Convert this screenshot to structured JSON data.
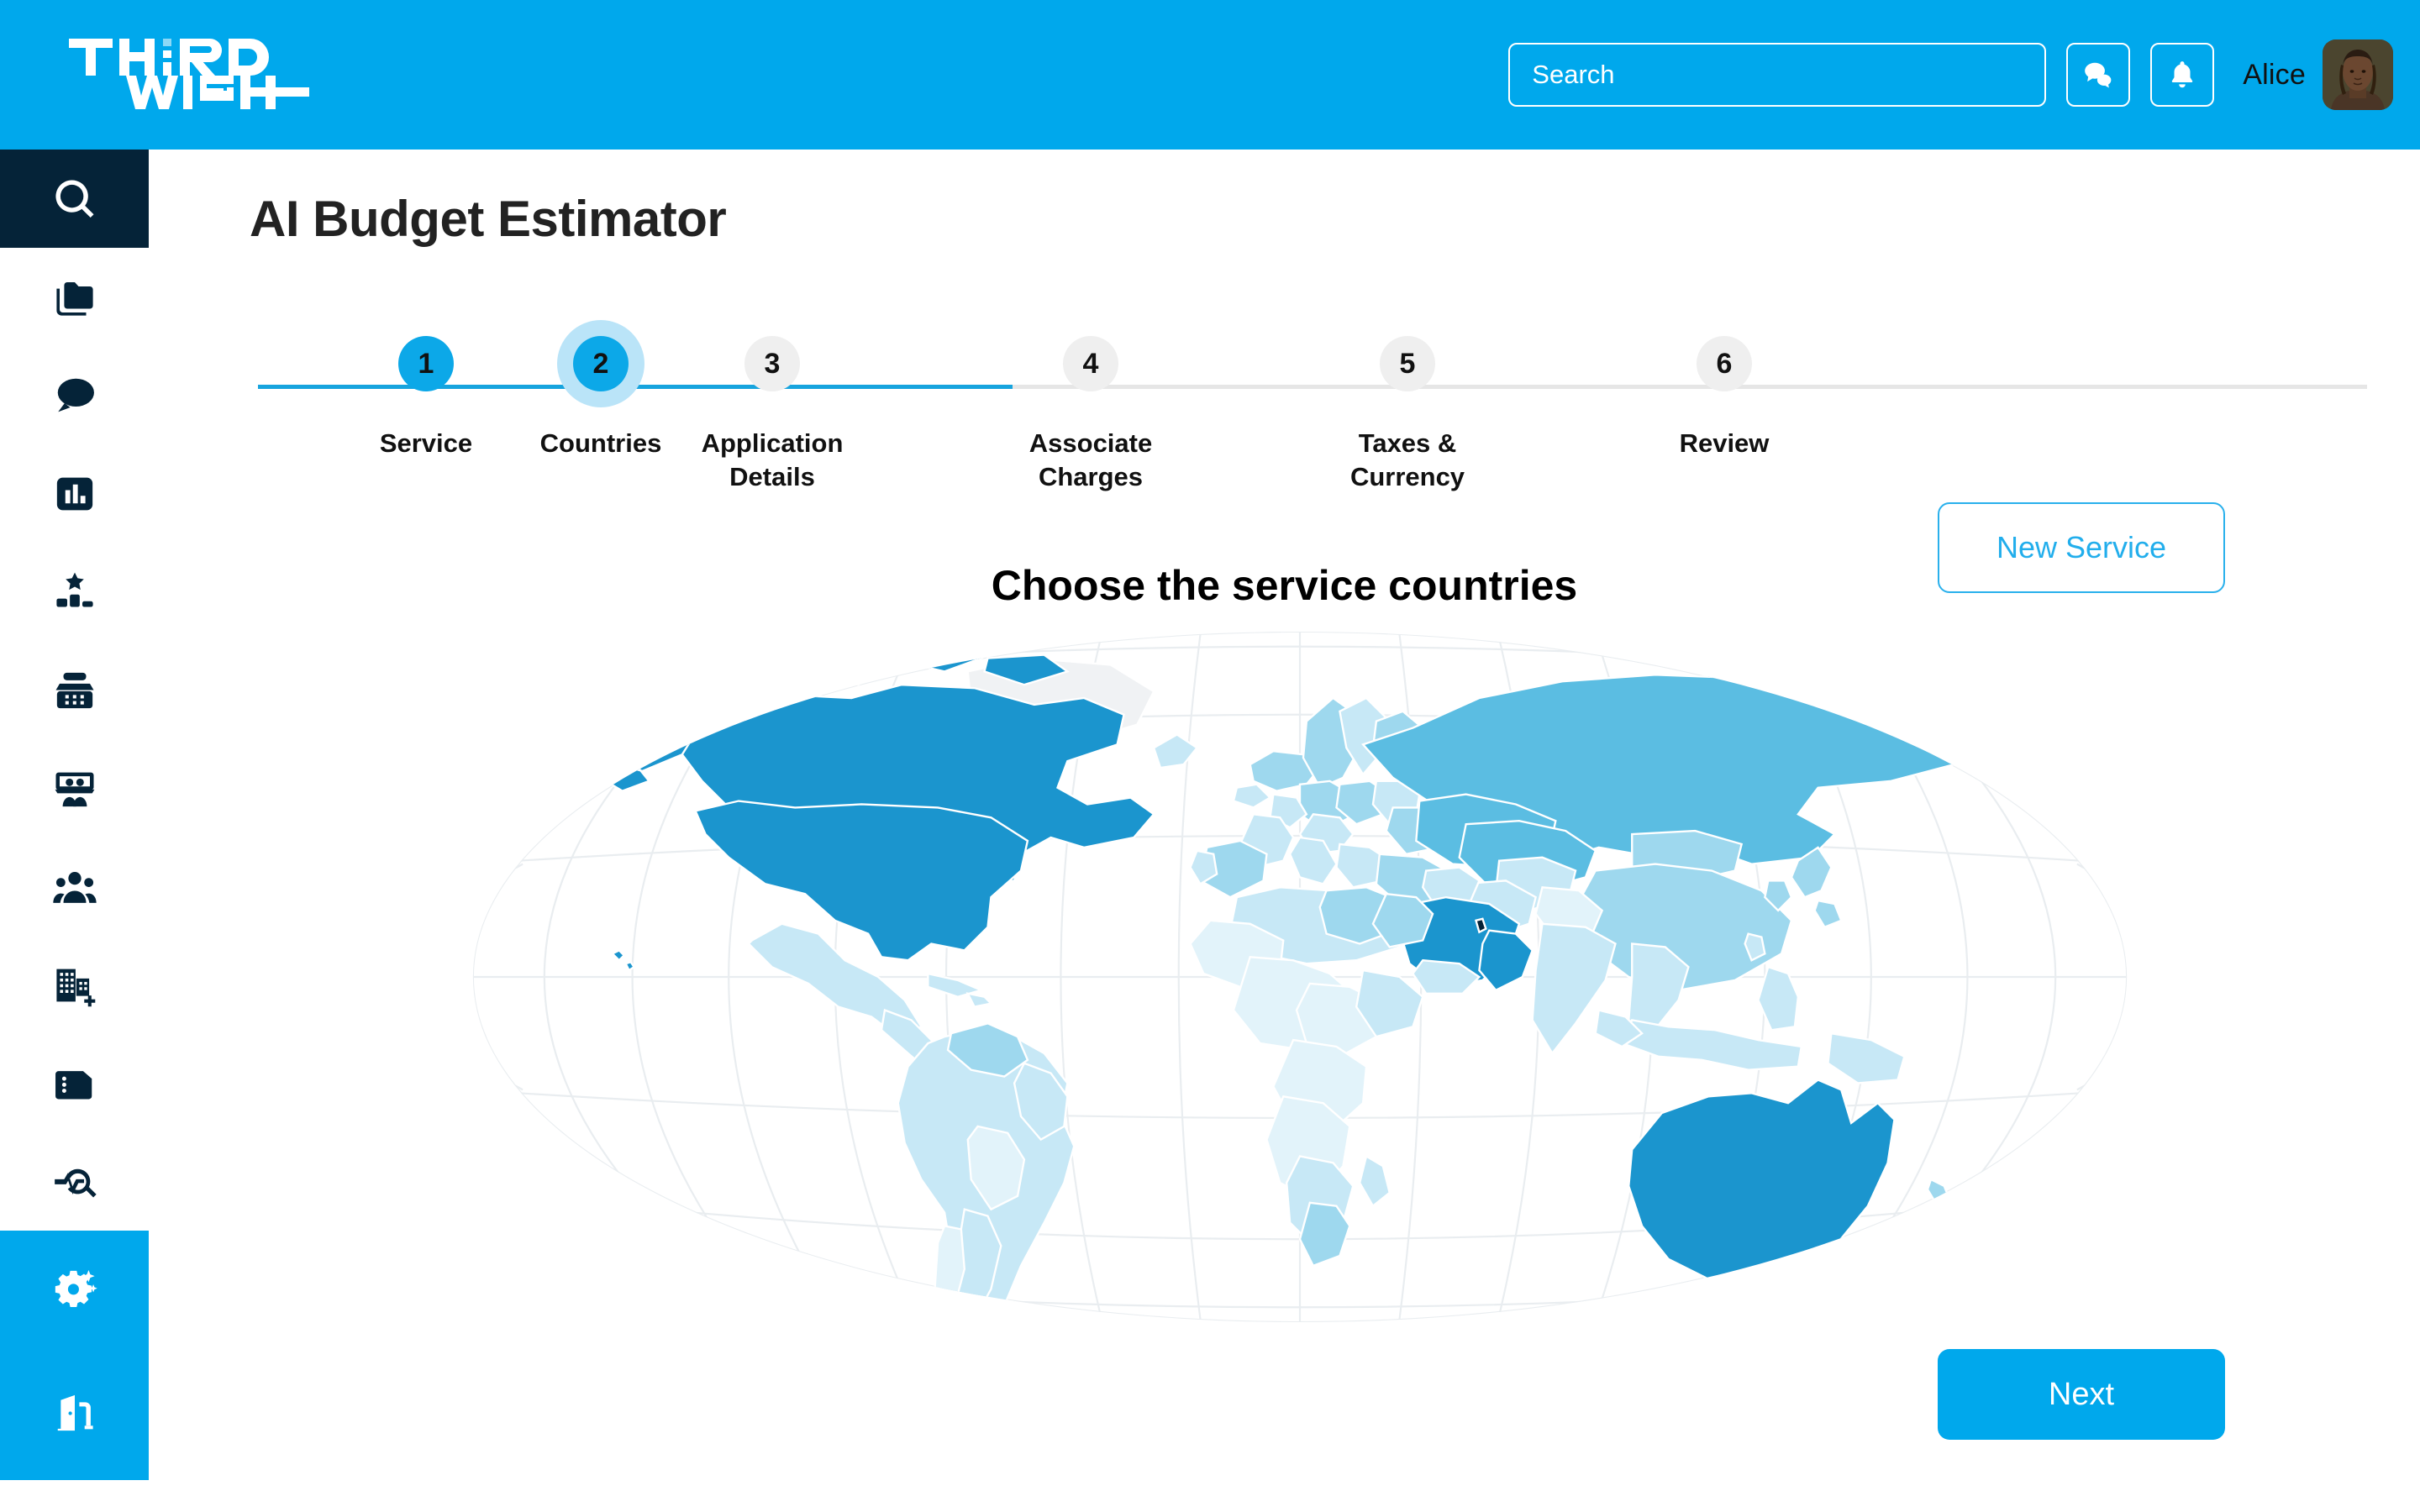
{
  "brand": {
    "logo_text_line1": "THIRD",
    "logo_text_line2": "WISH"
  },
  "header": {
    "search": {
      "placeholder": "Search",
      "value": ""
    },
    "messages_icon": "chat-bubbles-icon",
    "notifications_icon": "bell-icon",
    "user_name": "Alice",
    "background_color": "#00A8EC"
  },
  "sidebar": {
    "items": [
      {
        "icon": "search-icon",
        "name": "search",
        "active": true
      },
      {
        "icon": "folders-icon",
        "name": "folders",
        "active": false
      },
      {
        "icon": "chat-bubble-icon",
        "name": "messages",
        "active": false
      },
      {
        "icon": "bar-chart-icon",
        "name": "reports",
        "active": false
      },
      {
        "icon": "podium-star-icon",
        "name": "rankings",
        "active": false
      },
      {
        "icon": "cash-register-icon",
        "name": "point-of-sale",
        "active": false
      },
      {
        "icon": "presentation-people-icon",
        "name": "meetings",
        "active": false
      },
      {
        "icon": "people-group-icon",
        "name": "clients",
        "active": false
      },
      {
        "icon": "building-add-icon",
        "name": "companies",
        "active": false
      },
      {
        "icon": "document-menu-icon",
        "name": "documents",
        "active": false
      },
      {
        "icon": "analytics-search-icon",
        "name": "insights",
        "active": false
      }
    ],
    "bottom_items": [
      {
        "icon": "gear-sparkle-icon",
        "name": "ai-settings"
      },
      {
        "icon": "exit-door-icon",
        "name": "logout"
      }
    ],
    "active_background_color": "#052338",
    "bottom_background_color": "#00A8EC"
  },
  "main": {
    "page_title": "AI Budget Estimator",
    "section_heading": "Choose the service countries",
    "new_service_label": "New Service",
    "next_label": "Next",
    "stepper": {
      "current": 2,
      "steps": [
        {
          "number": "1",
          "label": "Service",
          "state": "done"
        },
        {
          "number": "2",
          "label": "Countries",
          "state": "current"
        },
        {
          "number": "3",
          "label": "Application Details",
          "state": "upcoming"
        },
        {
          "number": "4",
          "label": "Associate Charges",
          "state": "upcoming"
        },
        {
          "number": "5",
          "label": "Taxes & Currency",
          "state": "upcoming"
        },
        {
          "number": "6",
          "label": "Review",
          "state": "upcoming"
        }
      ]
    },
    "map": {
      "type": "world-choropleth",
      "projection": "robinson",
      "graticule": true,
      "selected_countries": [
        "United States",
        "Canada",
        "Saudi Arabia",
        "United Arab Emirates",
        "Australia"
      ],
      "colors": {
        "selected": "#1B95CE",
        "high": "#5BBDE2",
        "medium": "#9ED8EE",
        "low": "#C7E8F6",
        "lowest": "#E2F3FA",
        "nodata": "#F0F2F4",
        "border": "#FFFFFF",
        "graticule": "#E9EDF0"
      }
    }
  },
  "theme": {
    "accent": "#00A8EC",
    "dark": "#052338",
    "step_done": "#0CA8E8",
    "step_halo": "#BAE4F8",
    "step_idle": "#EFEFEF"
  }
}
